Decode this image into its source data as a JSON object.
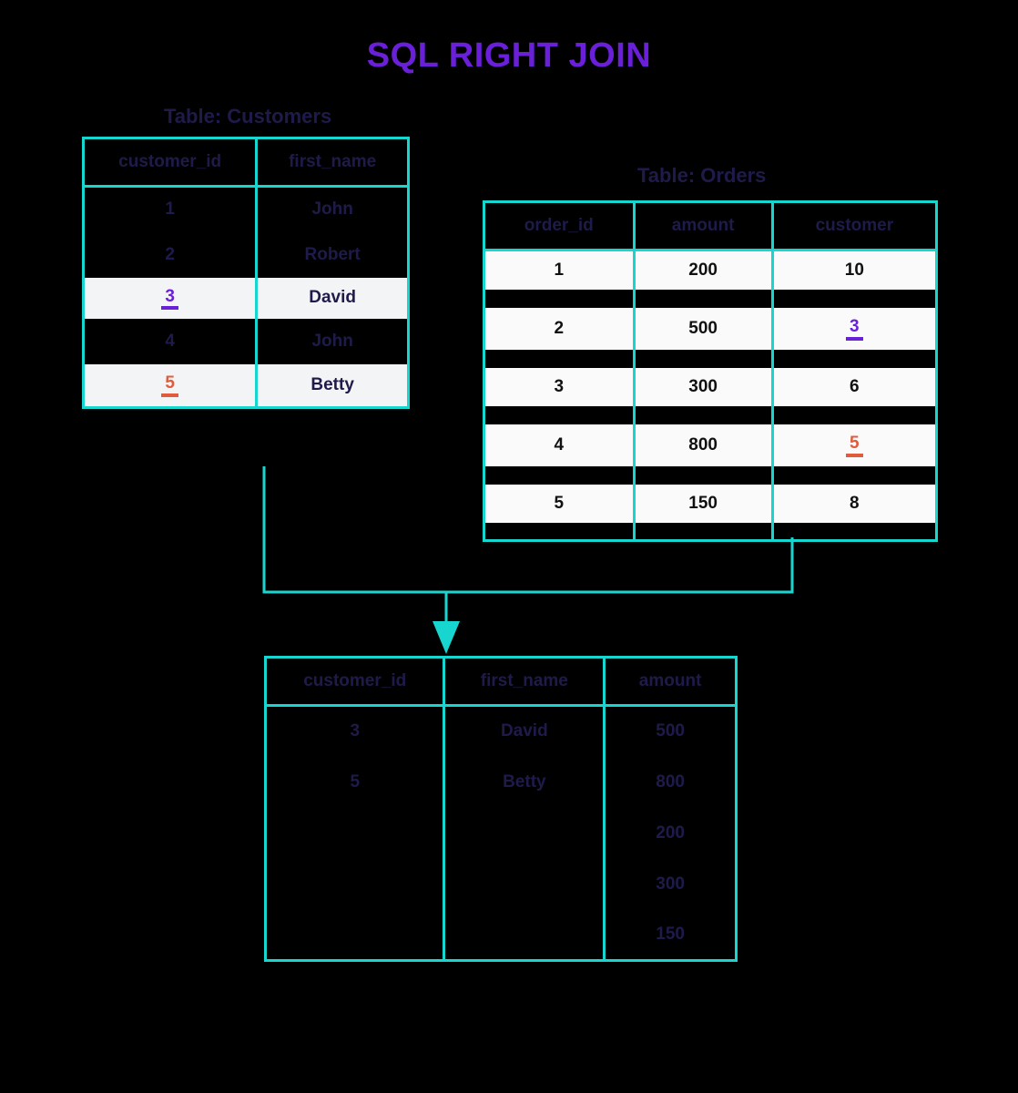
{
  "title": "SQL RIGHT JOIN",
  "customers": {
    "label": "Table: Customers",
    "columns": [
      "customer_id",
      "first_name"
    ],
    "rows": [
      {
        "id": "1",
        "name": "John",
        "highlight": null
      },
      {
        "id": "2",
        "name": "Robert",
        "highlight": null
      },
      {
        "id": "3",
        "name": "David",
        "highlight": "purple"
      },
      {
        "id": "4",
        "name": "John",
        "highlight": null
      },
      {
        "id": "5",
        "name": "Betty",
        "highlight": "red"
      }
    ]
  },
  "orders": {
    "label": "Table: Orders",
    "columns": [
      "order_id",
      "amount",
      "customer"
    ],
    "rows": [
      {
        "order_id": "1",
        "amount": "200",
        "customer": "10",
        "highlight": null
      },
      {
        "order_id": "2",
        "amount": "500",
        "customer": "3",
        "highlight": "purple"
      },
      {
        "order_id": "3",
        "amount": "300",
        "customer": "6",
        "highlight": null
      },
      {
        "order_id": "4",
        "amount": "800",
        "customer": "5",
        "highlight": "red"
      },
      {
        "order_id": "5",
        "amount": "150",
        "customer": "8",
        "highlight": null
      }
    ]
  },
  "result": {
    "columns": [
      "customer_id",
      "first_name",
      "amount"
    ],
    "rows": [
      {
        "customer_id": "3",
        "first_name": "David",
        "amount": "500"
      },
      {
        "customer_id": "5",
        "first_name": "Betty",
        "amount": "800"
      },
      {
        "customer_id": "",
        "first_name": "",
        "amount": "200"
      },
      {
        "customer_id": "",
        "first_name": "",
        "amount": "300"
      },
      {
        "customer_id": "",
        "first_name": "",
        "amount": "150"
      }
    ]
  }
}
